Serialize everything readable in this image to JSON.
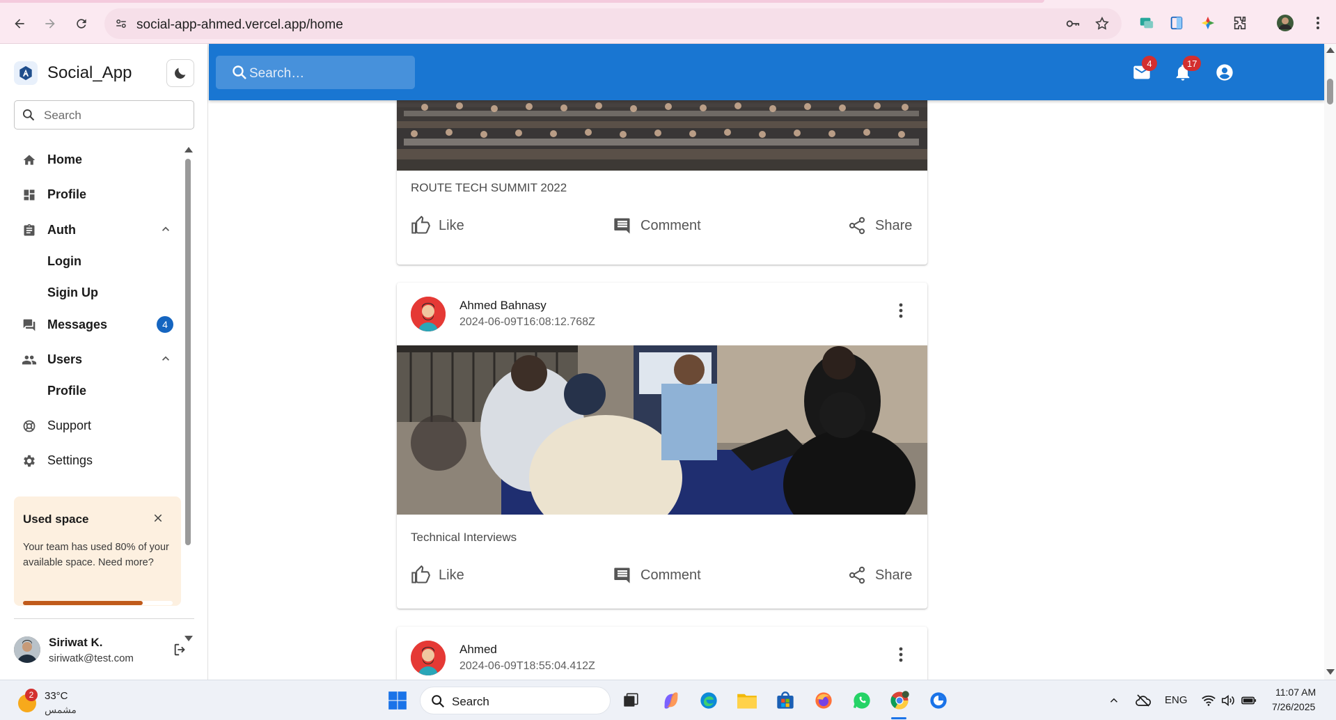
{
  "browser": {
    "url": "social-app-ahmed.vercel.app/home"
  },
  "sidebar": {
    "brand": "Social_App",
    "search_placeholder": "Search",
    "items": [
      {
        "label": "Home",
        "icon": "home-icon"
      },
      {
        "label": "Profile",
        "icon": "dashboard-icon"
      },
      {
        "label": "Auth",
        "icon": "clipboard-icon",
        "expanded": true,
        "children": [
          "Login",
          "Sigin Up"
        ]
      },
      {
        "label": "Messages",
        "icon": "chat-icon",
        "badge": "4"
      },
      {
        "label": "Users",
        "icon": "people-icon",
        "expanded": true,
        "children": [
          "Profile"
        ]
      },
      {
        "label": "Support",
        "icon": "support-icon"
      },
      {
        "label": "Settings",
        "icon": "gear-icon"
      }
    ],
    "used_space": {
      "title": "Used space",
      "text": "Your team has used 80% of your available space. Need more?",
      "percent": 80
    },
    "user": {
      "name": "Siriwat K.",
      "email": "siriwatk@test.com"
    }
  },
  "appbar": {
    "search_placeholder": "Search…",
    "mail_count": "4",
    "notification_count": "17",
    "color": "#1976d2"
  },
  "feed": {
    "actions": {
      "like": "Like",
      "comment": "Comment",
      "share": "Share"
    },
    "posts": [
      {
        "caption": "ROUTE TECH SUMMIT 2022"
      },
      {
        "author": "Ahmed Bahnasy",
        "date": "2024-06-09T16:08:12.768Z",
        "caption": "Technical Interviews"
      },
      {
        "author": "Ahmed",
        "date": "2024-06-09T18:55:04.412Z"
      }
    ]
  },
  "taskbar": {
    "weather_badge": "2",
    "temperature": "33°C",
    "condition": "مشمس",
    "search_placeholder": "Search",
    "language": "ENG",
    "time": "11:07 AM",
    "date": "7/26/2025"
  }
}
